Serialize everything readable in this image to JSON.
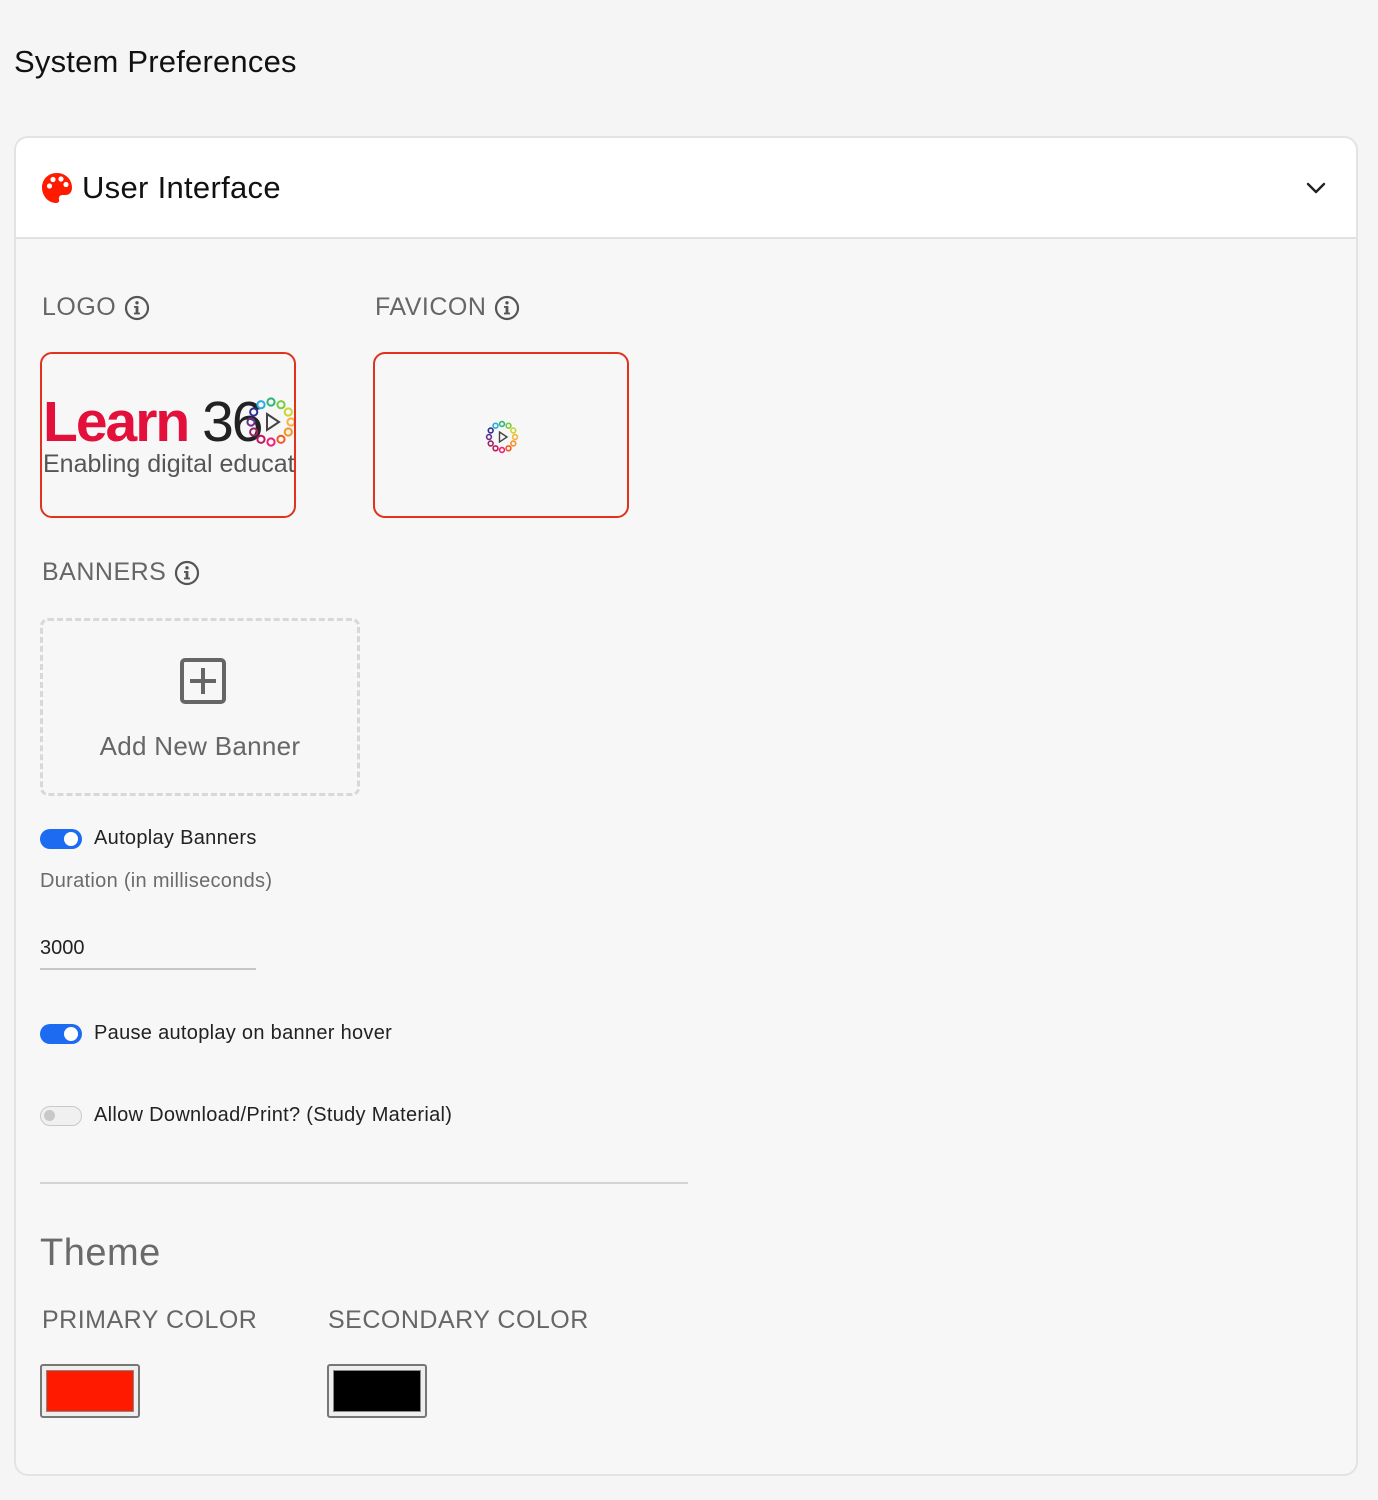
{
  "page": {
    "title": "System Preferences"
  },
  "section": {
    "title": "User Interface",
    "icon": "palette-icon",
    "collapse_icon": "chevron-down-icon"
  },
  "logo": {
    "label": "LOGO",
    "image_wordmark": "Learn36",
    "image_tagline": "Enabling digital educat"
  },
  "favicon": {
    "label": "FAVICON"
  },
  "banners": {
    "label": "BANNERS",
    "add_label": "Add New Banner",
    "add_icon": "plus-square-icon"
  },
  "autoplay": {
    "label": "Autoplay Banners",
    "enabled": true
  },
  "duration": {
    "label": "Duration (in milliseconds)",
    "value": "3000"
  },
  "pause_on_hover": {
    "label": "Pause autoplay on banner hover",
    "enabled": true
  },
  "allow_download": {
    "label": "Allow Download/Print? (Study Material)",
    "enabled": false
  },
  "theme": {
    "title": "Theme",
    "primary_label": "PRIMARY COLOR",
    "primary_color": "#ff1a00",
    "secondary_label": "SECONDARY COLOR",
    "secondary_color": "#000000"
  },
  "colors": {
    "accent_red": "#e0321c",
    "toggle_blue": "#1d6bf0",
    "brand_red": "#e3103c"
  }
}
